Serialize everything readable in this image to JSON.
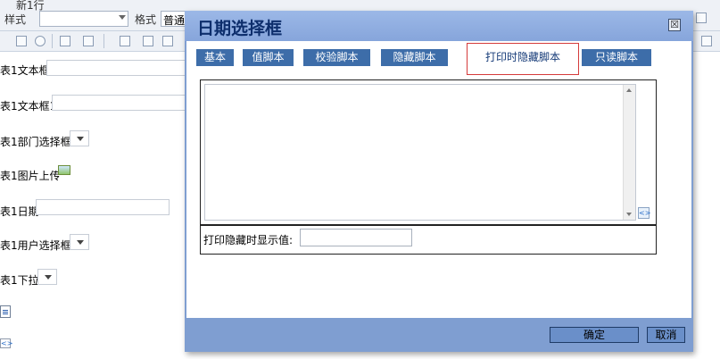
{
  "toolbar": {
    "style_label": "样式",
    "format_label": "格式",
    "format_value": "普通",
    "partial_text": "新1行"
  },
  "form": {
    "rows": [
      {
        "label": "表1文本框",
        "kind": "text"
      },
      {
        "label": "表1文本框1",
        "kind": "text"
      },
      {
        "label": "表1部门选择框",
        "kind": "dropdown"
      },
      {
        "label": "表1图片上传",
        "kind": "image"
      },
      {
        "label": "表1日期",
        "kind": "text"
      },
      {
        "label": "表1用户选择框",
        "kind": "dropdown"
      },
      {
        "label": "表1下拉",
        "kind": "dropdown"
      }
    ]
  },
  "dialog": {
    "title": "日期选择框",
    "close_glyph": "☒",
    "tabs": [
      {
        "label": "基本"
      },
      {
        "label": "值脚本"
      },
      {
        "label": "校验脚本"
      },
      {
        "label": "隐藏脚本"
      },
      {
        "label": "打印时隐藏脚本",
        "active": true
      },
      {
        "label": "只读脚本"
      }
    ],
    "script_value": "",
    "print_hide_label": "打印隐藏时显示值:",
    "print_hide_value": "",
    "ok_label": "确定",
    "cancel_label": "取消"
  },
  "colors": {
    "dialog_frame": "#7f9ed1",
    "tab_bg": "#3d6da9",
    "active_tab_border": "#d53b3b",
    "title_text": "#0d2e6c"
  }
}
